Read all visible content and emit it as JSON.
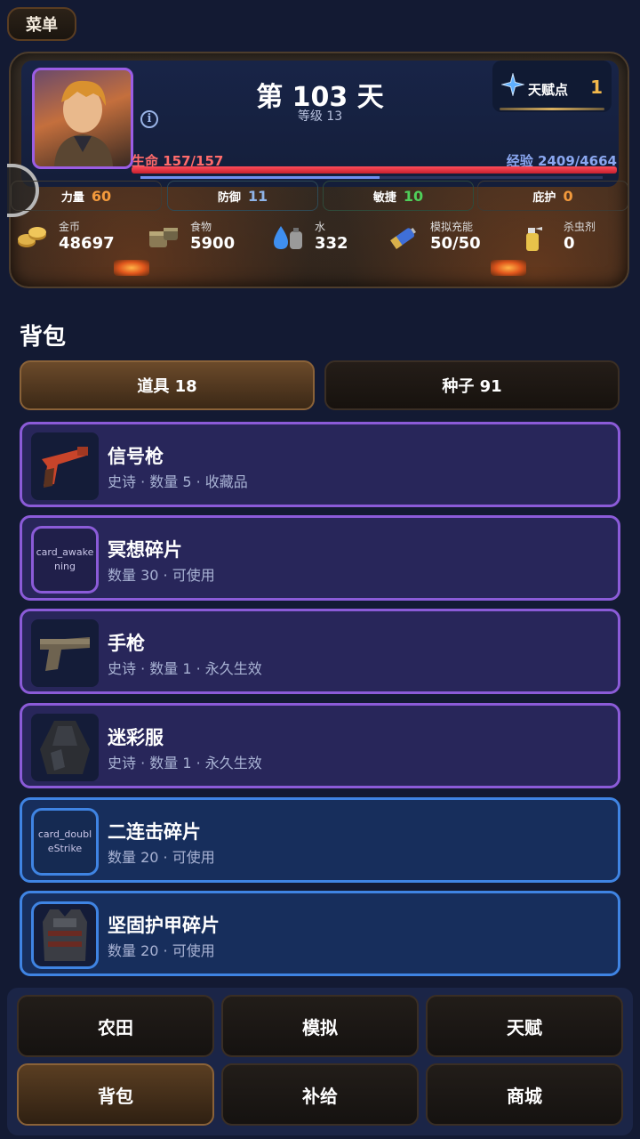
{
  "menu": {
    "label": "菜单"
  },
  "status": {
    "day_title": "第 103 天",
    "level": "等级 13",
    "talent": {
      "label": "天赋点",
      "value": "1"
    },
    "hp_text": "生命 157/157",
    "hp_fraction": 1.0,
    "xp_text": "经验 2409/4664",
    "xp_fraction": 0.5165,
    "stats": [
      {
        "label": "力量",
        "value": "60",
        "color": "#f39a3c"
      },
      {
        "label": "防御",
        "value": "11",
        "color": "#8fb4e8"
      },
      {
        "label": "敏捷",
        "value": "10",
        "color": "#4fcf5a"
      },
      {
        "label": "庇护",
        "value": "0",
        "color": "#f39a3c"
      }
    ],
    "resources": [
      {
        "label": "金币",
        "value": "48697",
        "icon": "coins-icon"
      },
      {
        "label": "食物",
        "value": "5900",
        "icon": "food-can-icon"
      },
      {
        "label": "水",
        "value": "332",
        "icon": "water-icon"
      },
      {
        "label": "模拟充能",
        "value": "50/50",
        "icon": "battery-icon"
      },
      {
        "label": "杀虫剂",
        "value": "0",
        "icon": "spray-icon"
      }
    ]
  },
  "backpack": {
    "title": "背包",
    "tabs": [
      {
        "label": "道具 18",
        "active": true
      },
      {
        "label": "种子 91",
        "active": false
      }
    ],
    "items": [
      {
        "name": "信号枪",
        "desc": "史诗 · 数量 5 · 收藏品",
        "icon": "flare-gun-icon",
        "thumb_text": "",
        "rarity": "purple"
      },
      {
        "name": "冥想碎片",
        "desc": "数量 30 · 可使用",
        "icon": "card-icon",
        "thumb_text": "card_awakening",
        "rarity": "purple"
      },
      {
        "name": "手枪",
        "desc": "史诗 · 数量 1 · 永久生效",
        "icon": "pistol-icon",
        "thumb_text": "",
        "rarity": "purple"
      },
      {
        "name": "迷彩服",
        "desc": "史诗 · 数量 1 · 永久生效",
        "icon": "camo-cloak-icon",
        "thumb_text": "",
        "rarity": "purple"
      },
      {
        "name": "二连击碎片",
        "desc": "数量 20 · 可使用",
        "icon": "card-icon",
        "thumb_text": "card_doubleStrike",
        "rarity": "blue"
      },
      {
        "name": "坚固护甲碎片",
        "desc": "数量 20 · 可使用",
        "icon": "armor-vest-icon",
        "thumb_text": "",
        "rarity": "blue"
      }
    ]
  },
  "nav": [
    {
      "label": "农田",
      "active": false
    },
    {
      "label": "模拟",
      "active": false
    },
    {
      "label": "天赋",
      "active": false
    },
    {
      "label": "背包",
      "active": true
    },
    {
      "label": "补给",
      "active": false
    },
    {
      "label": "商城",
      "active": false
    }
  ]
}
